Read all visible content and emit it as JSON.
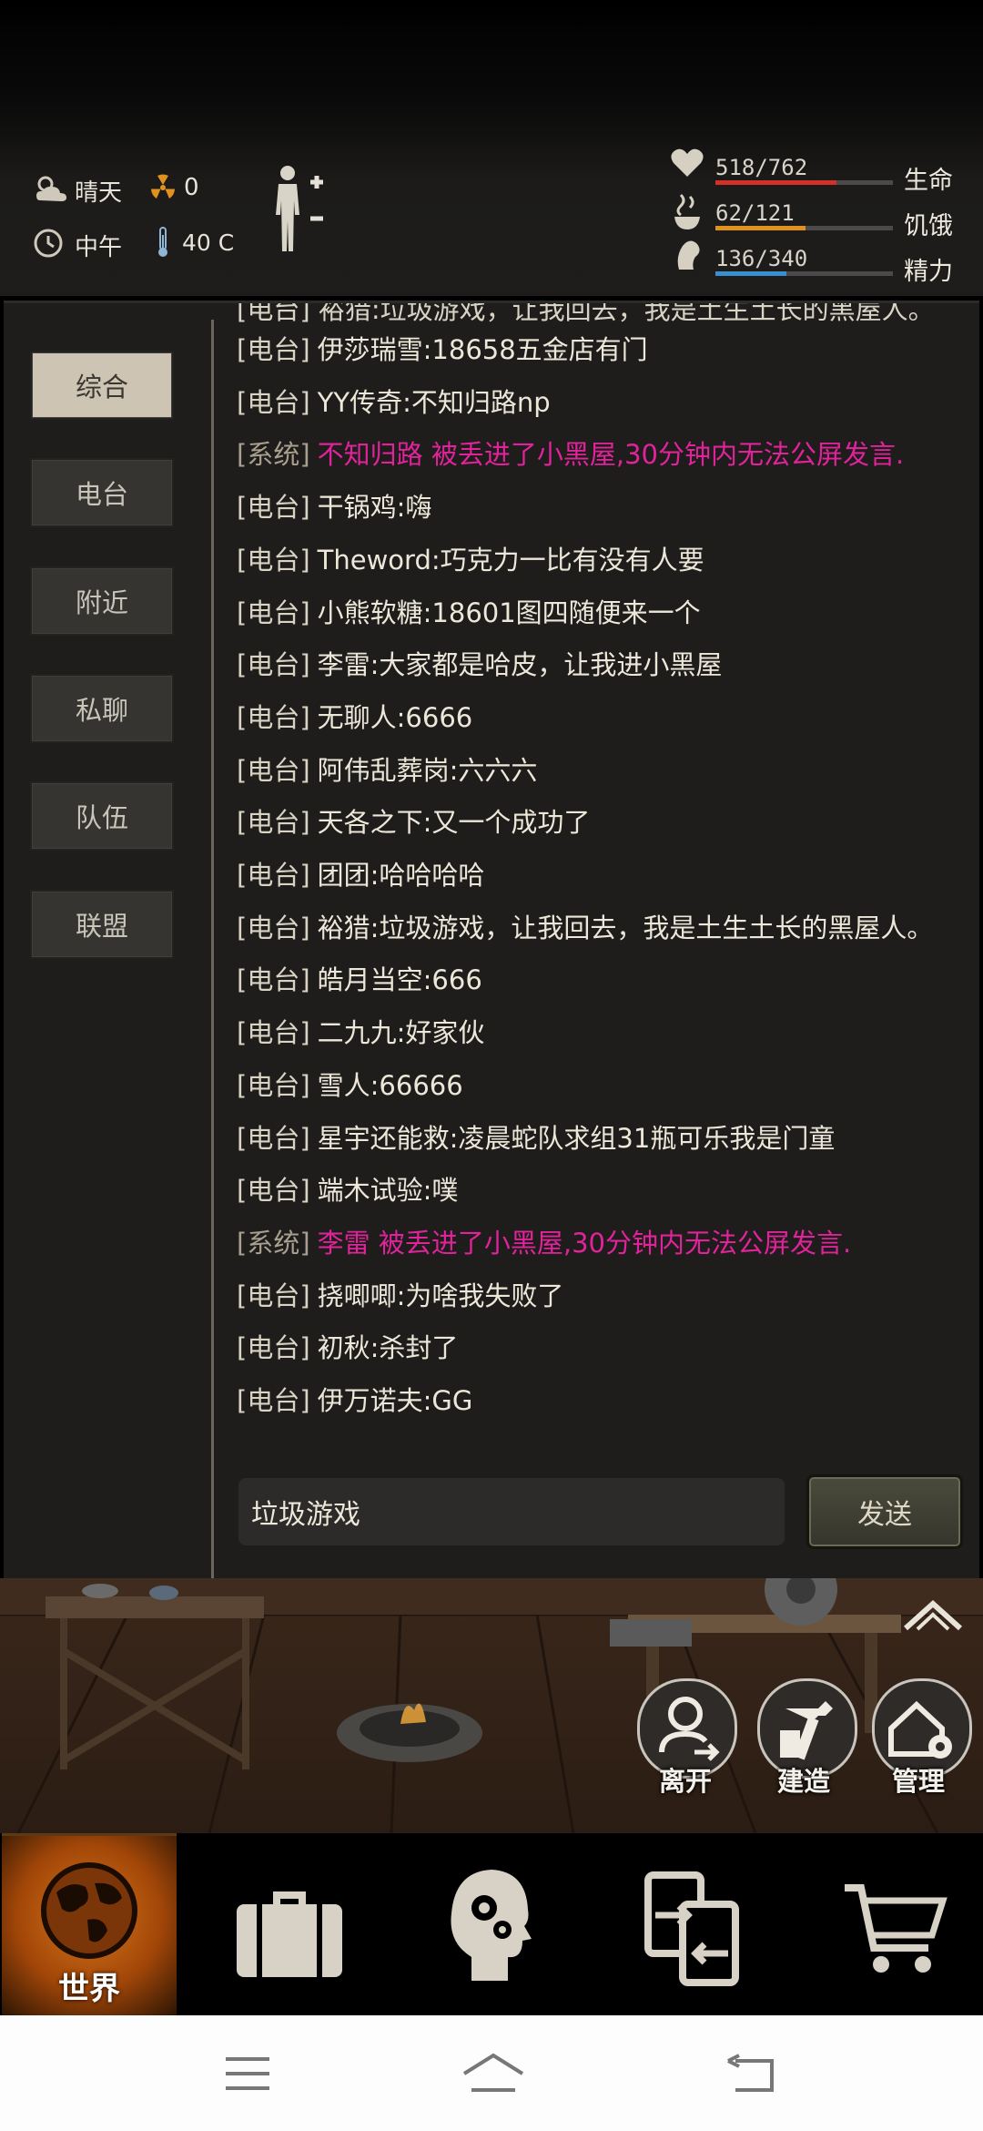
{
  "status": {
    "weather": "晴天",
    "radiation": "0",
    "time_of_day": "中午",
    "temperature": "40 C"
  },
  "vitals": [
    {
      "value": "518/762",
      "name": "生命",
      "level": 0.68,
      "color": "#d3302a",
      "icon": "heart-icon"
    },
    {
      "value": "62/121",
      "name": "饥饿",
      "level": 0.51,
      "color": "#e0921e",
      "icon": "hunger-icon"
    },
    {
      "value": "136/340",
      "name": "精力",
      "level": 0.4,
      "color": "#3a8fd1",
      "icon": "energy-icon"
    }
  ],
  "tabs": [
    "综合",
    "电台",
    "附近",
    "私聊",
    "队伍",
    "联盟"
  ],
  "active_tab": "综合",
  "chat": {
    "cutoff_top": "[电台] 裕猎:垃圾游戏，让我回去，我是土生土长的黑屋人。",
    "messages": [
      {
        "channel": "[电台]",
        "text": "伊莎瑞雪:18658五金店有门",
        "system": false
      },
      {
        "channel": "[电台]",
        "text": "YY传奇:不知归路np",
        "system": false
      },
      {
        "channel": "[系统]",
        "text": "不知归路 被丢进了小黑屋,30分钟内无法公屏发言.",
        "system": true
      },
      {
        "channel": "[电台]",
        "text": "干锅鸡:嗨",
        "system": false
      },
      {
        "channel": "[电台]",
        "text": "Theword:巧克力一比有没有人要",
        "system": false
      },
      {
        "channel": "[电台]",
        "text": "小熊软糖:18601图四随便来一个",
        "system": false
      },
      {
        "channel": "[电台]",
        "text": "李雷:大家都是哈皮，让我进小黑屋",
        "system": false
      },
      {
        "channel": "[电台]",
        "text": "无聊人:6666",
        "system": false
      },
      {
        "channel": "[电台]",
        "text": "阿伟乱葬岗:六六六",
        "system": false
      },
      {
        "channel": "[电台]",
        "text": "天各之下:又一个成功了",
        "system": false
      },
      {
        "channel": "[电台]",
        "text": "团团:哈哈哈哈",
        "system": false
      },
      {
        "channel": "[电台]",
        "text": "裕猎:垃圾游戏，让我回去，我是土生土长的黑屋人。",
        "system": false
      },
      {
        "channel": "[电台]",
        "text": "皓月当空:666",
        "system": false
      },
      {
        "channel": "[电台]",
        "text": "二九九:好家伙",
        "system": false
      },
      {
        "channel": "[电台]",
        "text": "雪人:66666",
        "system": false
      },
      {
        "channel": "[电台]",
        "text": "星宇还能救:凌晨蛇队求组31瓶可乐我是门童",
        "system": false
      },
      {
        "channel": "[电台]",
        "text": "端木试验:噗",
        "system": false
      },
      {
        "channel": "[系统]",
        "text": "李雷 被丢进了小黑屋,30分钟内无法公屏发言.",
        "system": true
      },
      {
        "channel": "[电台]",
        "text": "挠唧唧:为啥我失败了",
        "system": false
      },
      {
        "channel": "[电台]",
        "text": "初秋:杀封了",
        "system": false
      },
      {
        "channel": "[电台]",
        "text": "伊万诺夫:GG",
        "system": false
      }
    ],
    "input_value": "垃圾游戏",
    "send_label": "发送"
  },
  "actions": [
    "离开",
    "建造",
    "管理"
  ],
  "bottom_nav": {
    "world_label": "世界",
    "items": [
      "globe-icon",
      "backpack-icon",
      "skills-head-icon",
      "trade-icon",
      "cart-icon"
    ]
  },
  "colors": {
    "system_message": "#e0239a",
    "accent_orange": "#d7751a"
  }
}
